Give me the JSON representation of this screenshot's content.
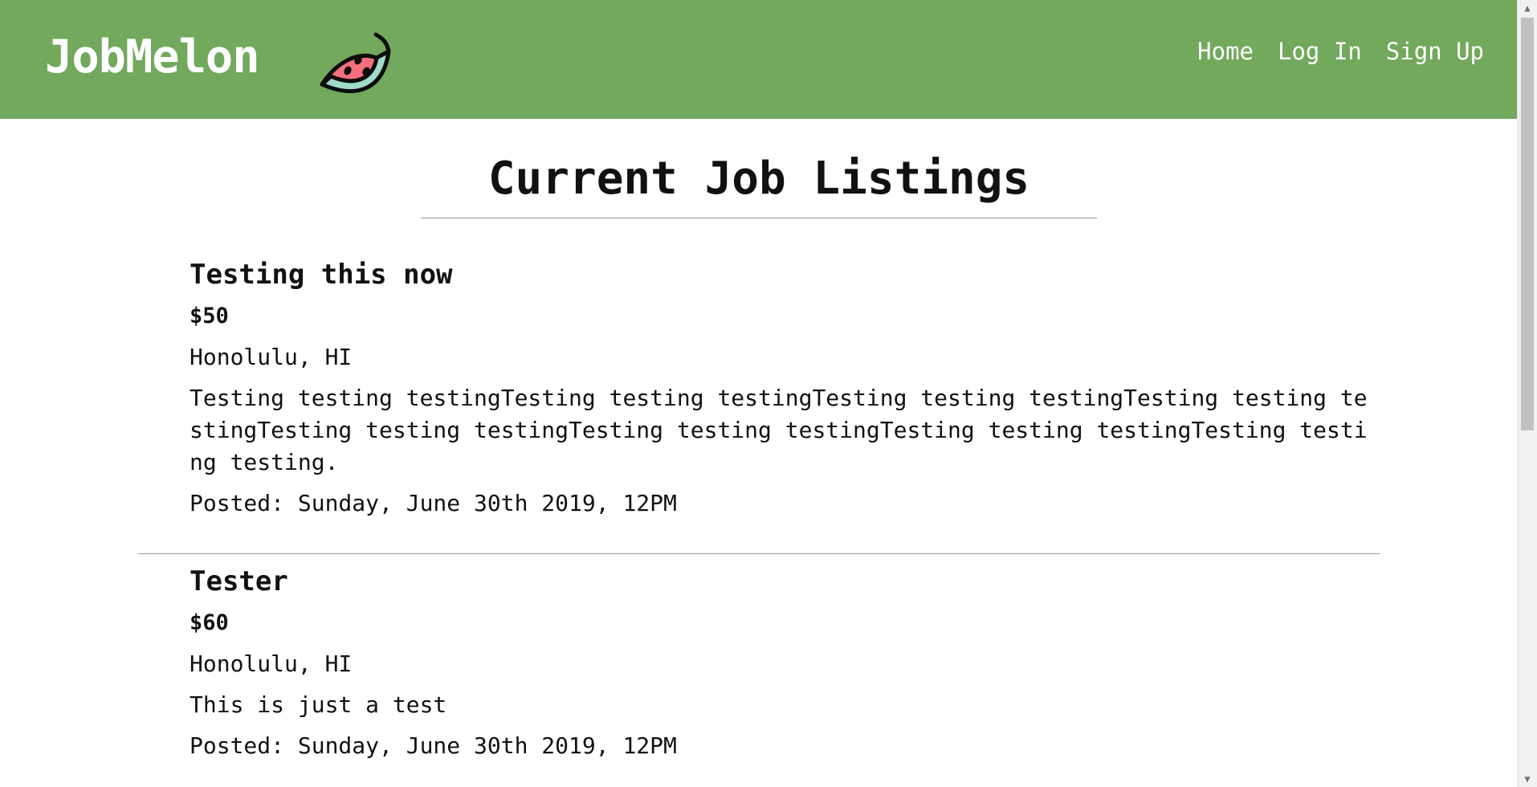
{
  "header": {
    "brand": "JobMelon",
    "logo_icon": "watermelon-icon",
    "nav": [
      {
        "label": "Home"
      },
      {
        "label": "Log In"
      },
      {
        "label": "Sign Up"
      }
    ],
    "colors": {
      "navbar": "#72a95d",
      "text": "#ffffff"
    }
  },
  "main": {
    "title": "Current Job Listings",
    "listings": [
      {
        "title": "Testing this now",
        "pay": "$50",
        "location": "Honolulu, HI",
        "description": "Testing testing testingTesting testing testingTesting testing testingTesting testing testingTesting testing testingTesting testing testingTesting testing testingTesting testing testing.",
        "posted": "Posted: Sunday, June 30th 2019, 12PM"
      },
      {
        "title": "Tester",
        "pay": "$60",
        "location": "Honolulu, HI",
        "description": "This is just a test",
        "posted": "Posted: Sunday, June 30th 2019, 12PM"
      }
    ]
  },
  "scrollbar": {
    "up_icon": "chevron-up-icon",
    "down_icon": "chevron-down-icon"
  }
}
